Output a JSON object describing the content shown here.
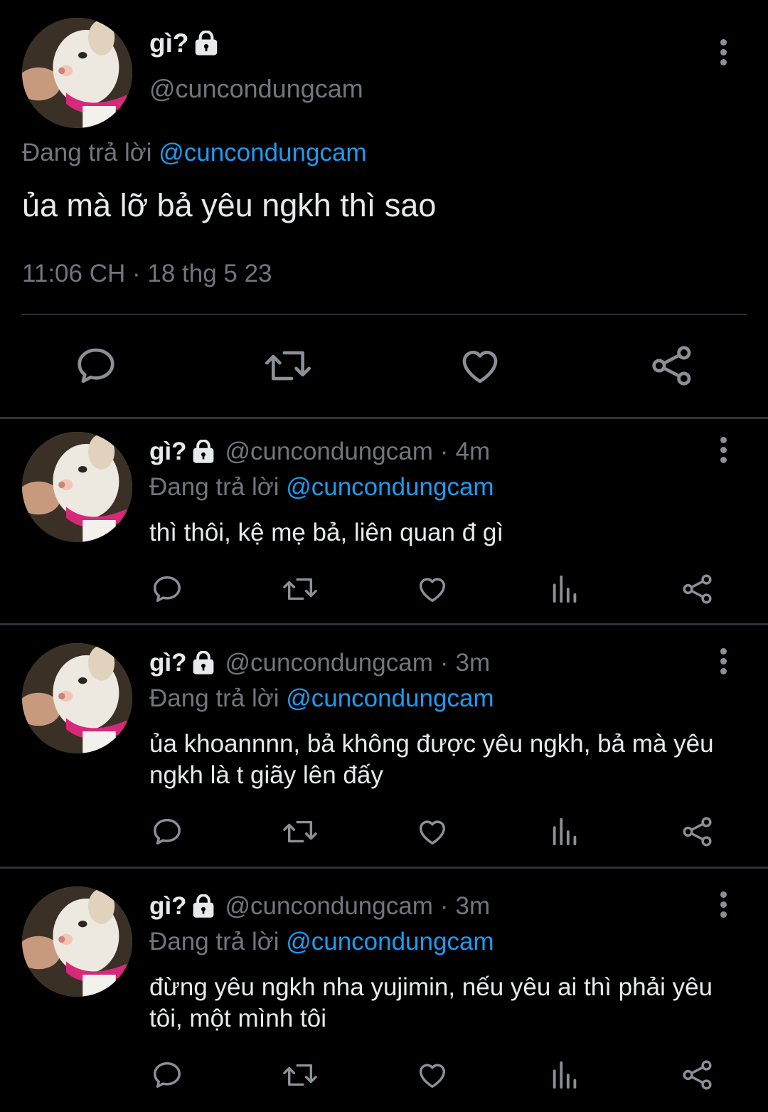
{
  "main_tweet": {
    "display_name": "gì?",
    "handle": "@cuncondungcam",
    "reply_prefix": "Đang trả lời",
    "reply_to": "@cuncondungcam",
    "text": "ủa mà lỡ bả yêu ngkh thì sao",
    "timestamp": "11:06 CH · 18 thg 5 23",
    "icons": [
      "lock-icon",
      "more-vert-icon",
      "reply-icon",
      "retweet-icon",
      "like-icon",
      "share-icon"
    ]
  },
  "replies": [
    {
      "display_name": "gì?",
      "handle": "@cuncondungcam",
      "separator": "·",
      "time": "4m",
      "reply_prefix": "Đang trả lời",
      "reply_to": "@cuncondungcam",
      "text": "thì thôi, kệ mẹ bả, liên quan đ gì"
    },
    {
      "display_name": "gì?",
      "handle": "@cuncondungcam",
      "separator": "·",
      "time": "3m",
      "reply_prefix": "Đang trả lời",
      "reply_to": "@cuncondungcam",
      "text": "ủa khoannnn, bả không được yêu ngkh, bả mà yêu ngkh là t giãy lên đấy"
    },
    {
      "display_name": "gì?",
      "handle": "@cuncondungcam",
      "separator": "·",
      "time": "3m",
      "reply_prefix": "Đang trả lời",
      "reply_to": "@cuncondungcam",
      "text": "đừng yêu ngkh nha yujimin, nếu yêu ai thì phải yêu tôi, một mình tôi"
    }
  ],
  "colors": {
    "background": "#000000",
    "text": "#e7e9ea",
    "secondary": "#71767b",
    "mention": "#1d9bf0",
    "divider": "#2f3336"
  }
}
